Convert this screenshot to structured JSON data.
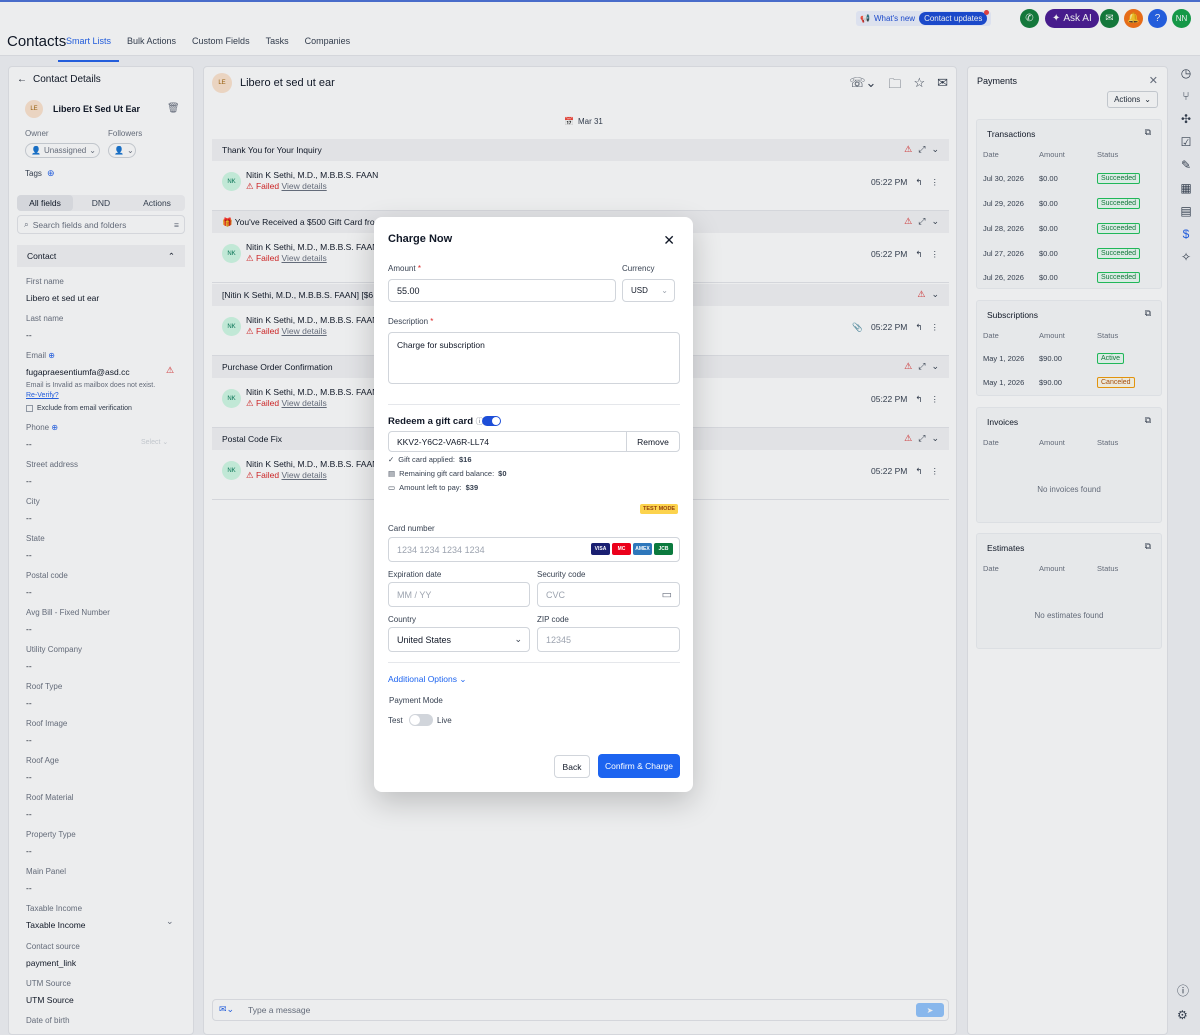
{
  "app": {
    "title": "Contacts"
  },
  "nav_tabs": [
    "Smart Lists",
    "Bulk Actions",
    "Custom Fields",
    "Tasks",
    "Companies"
  ],
  "topbar": {
    "whats_new": "What's new",
    "contact_updates": "Contact updates",
    "ask_ai": "Ask AI",
    "user_initials": "NN"
  },
  "left": {
    "title": "Contact Details",
    "avatar": "LE",
    "name": "Libero Et Sed Ut Ear",
    "owner_label": "Owner",
    "owner_value": "Unassigned",
    "followers_label": "Followers",
    "tags_label": "Tags",
    "segments": [
      "All fields",
      "DND",
      "Actions"
    ],
    "search_placeholder": "Search fields and folders",
    "section": "Contact",
    "fields": [
      {
        "label": "First name",
        "value": "Libero et sed ut ear"
      },
      {
        "label": "Last name",
        "value": "--"
      },
      {
        "label": "Email",
        "value": "fugapraesentiumfa@asd.cc"
      },
      {
        "label": "Phone",
        "value": "--"
      },
      {
        "label": "Street address",
        "value": "--"
      },
      {
        "label": "City",
        "value": "--"
      },
      {
        "label": "State",
        "value": "--"
      },
      {
        "label": "Postal code",
        "value": "--"
      },
      {
        "label": "Avg Bill - Fixed Number",
        "value": "--"
      },
      {
        "label": "Utility Company",
        "value": "--"
      },
      {
        "label": "Roof Type",
        "value": "--"
      },
      {
        "label": "Roof Image",
        "value": "--"
      },
      {
        "label": "Roof Age",
        "value": "--"
      },
      {
        "label": "Roof Material",
        "value": "--"
      },
      {
        "label": "Property Type",
        "value": "--"
      },
      {
        "label": "Main Panel",
        "value": "--"
      },
      {
        "label": "Taxable Income",
        "value": "Taxable Income"
      },
      {
        "label": "Contact source",
        "value": "payment_link"
      },
      {
        "label": "UTM Source",
        "value": "UTM Source"
      },
      {
        "label": "Date of birth",
        "value": ""
      }
    ],
    "email_warning": "Email is Invalid as mailbox does not exist.",
    "reverify": "Re-Verify?",
    "exclude_label": "Exclude from email verification",
    "phone_select": "Select"
  },
  "middle": {
    "avatar": "LE",
    "title": "Libero et sed ut ear",
    "date": "Mar 31",
    "threads": [
      {
        "subject": "Thank You for Your Inquiry",
        "sender": "Nitin K Sethi, M.D., M.B.B.S. FAAN",
        "status": "Failed",
        "link": "View details",
        "time": "05:22 PM"
      },
      {
        "subject": "🎁 You've Received a $500 Gift Card fro",
        "sender": "Nitin K Sethi, M.D., M.B.B.S. FAAN",
        "status": "Failed",
        "link": "View details",
        "time": "05:22 PM"
      },
      {
        "subject": "[Nitin K Sethi, M.D., M.B.B.S. FAAN] [$6",
        "sender": "Nitin K Sethi, M.D., M.B.B.S. FAAN",
        "status": "Failed",
        "link": "View details",
        "time": "05:22 PM"
      },
      {
        "subject": "Purchase Order Confirmation",
        "sender": "Nitin K Sethi, M.D., M.B.B.S. FAAN",
        "status": "Failed",
        "link": "View details",
        "time": "05:22 PM"
      },
      {
        "subject": "Postal Code Fix",
        "sender": "Nitin K Sethi, M.D., M.B.B.S. FAAN",
        "status": "Failed",
        "link": "View details",
        "time": "05:22 PM"
      }
    ],
    "sender_avatar": "NK",
    "composer_placeholder": "Type a message"
  },
  "right": {
    "title": "Payments",
    "actions": "Actions",
    "transactions": {
      "title": "Transactions",
      "headers": [
        "Date",
        "Amount",
        "Status"
      ],
      "rows": [
        {
          "date": "Jul 30, 2026",
          "amount": "$0.00",
          "status": "Succeeded"
        },
        {
          "date": "Jul 29, 2026",
          "amount": "$0.00",
          "status": "Succeeded"
        },
        {
          "date": "Jul 28, 2026",
          "amount": "$0.00",
          "status": "Succeeded"
        },
        {
          "date": "Jul 27, 2026",
          "amount": "$0.00",
          "status": "Succeeded"
        },
        {
          "date": "Jul 26, 2026",
          "amount": "$0.00",
          "status": "Succeeded"
        }
      ]
    },
    "subscriptions": {
      "title": "Subscriptions",
      "headers": [
        "Date",
        "Amount",
        "Status"
      ],
      "rows": [
        {
          "date": "May 1, 2026",
          "amount": "$90.00",
          "status": "Active"
        },
        {
          "date": "May 1, 2026",
          "amount": "$90.00",
          "status": "Canceled"
        }
      ]
    },
    "invoices": {
      "title": "Invoices",
      "headers": [
        "Date",
        "Amount",
        "Status"
      ],
      "empty": "No invoices found"
    },
    "estimates": {
      "title": "Estimates",
      "headers": [
        "Date",
        "Amount",
        "Status"
      ],
      "empty": "No estimates found"
    }
  },
  "modal": {
    "title": "Charge Now",
    "amount_label": "Amount",
    "amount_value": "55.00",
    "currency_label": "Currency",
    "currency_value": "USD",
    "description_label": "Description",
    "description_value": "Charge for subscription",
    "gift_label": "Redeem a gift card",
    "gift_code": "KKV2-Y6C2-VA6R-LL74",
    "remove": "Remove",
    "gift_applied_label": "Gift card applied:",
    "gift_applied_value": "$16",
    "remaining_label": "Remaining gift card balance:",
    "remaining_value": "$0",
    "left_label": "Amount left to pay:",
    "left_value": "$39",
    "test_mode": "TEST MODE",
    "card_number_label": "Card number",
    "card_number_placeholder": "1234 1234 1234 1234",
    "expiry_label": "Expiration date",
    "expiry_placeholder": "MM / YY",
    "security_label": "Security code",
    "security_placeholder": "CVC",
    "country_label": "Country",
    "country_value": "United States",
    "zip_label": "ZIP code",
    "zip_placeholder": "12345",
    "additional_options": "Additional Options",
    "payment_mode_label": "Payment Mode",
    "mode_test": "Test",
    "mode_live": "Live",
    "back": "Back",
    "confirm": "Confirm & Charge",
    "card_brands": [
      "VISA",
      "MC",
      "AMEX",
      "JCB"
    ]
  },
  "colors": {
    "accent": "#1d64f0",
    "danger": "#dc2626",
    "success": "#15803d"
  }
}
